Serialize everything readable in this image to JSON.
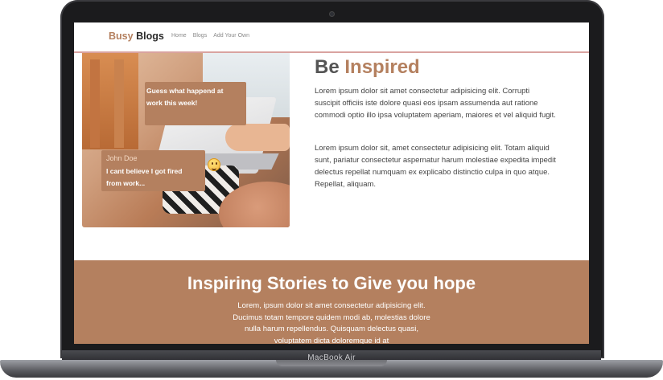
{
  "device": {
    "model_label": "MacBook Air"
  },
  "nav": {
    "brand_part1": "Busy",
    "brand_part2": "Blogs",
    "links": [
      "Home",
      "Blogs",
      "Add Your Own"
    ]
  },
  "hero": {
    "bubble1_text": "Guess what happend at work this week!",
    "bubble2_name": "John Doe",
    "bubble2_text": "I cant believe I got fired from work..."
  },
  "content": {
    "title_part1": "Be",
    "title_part2": "Inspired",
    "paragraph1": "Lorem ipsum dolor sit amet consectetur adipisicing elit. Corrupti suscipit officiis iste dolore quasi eos ipsam assumenda aut ratione commodi optio illo ipsa voluptatem aperiam, maiores et vel aliquid fugit.",
    "paragraph2": "Lorem ipsum dolor sit, amet consectetur adipisicing elit. Totam aliquid sunt, pariatur consectetur aspernatur harum molestiae expedita impedit delectus repellat numquam ex explicabo distinctio culpa in quo atque. Repellat, aliquam."
  },
  "band": {
    "title": "Inspiring Stories to Give you hope",
    "text": "Lorem, ipsum dolor sit amet consectetur adipisicing elit. Ducimus totam tempore quidem modi ab, molestias dolore nulla harum repellendus. Quisquam delectus quasi, voluptatem dicta doloremque id at"
  },
  "colors": {
    "accent": "#b4805f",
    "nav_border": "#d9a3a0"
  }
}
